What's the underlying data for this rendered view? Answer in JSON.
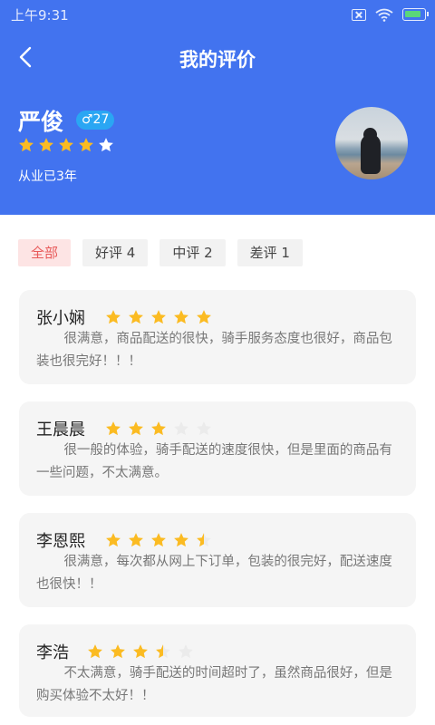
{
  "status_bar": {
    "time": "上午9:31",
    "battery_level": 0.75,
    "icons": [
      "sim-off-icon",
      "wifi-icon",
      "battery-charging-icon"
    ]
  },
  "nav": {
    "title": "我的评价",
    "back_icon": "back-arrow-icon"
  },
  "profile": {
    "name": "严俊",
    "gender_age": "♂27",
    "rating": 4,
    "rating_max": 5,
    "experience": "从业已3年"
  },
  "tabs": [
    {
      "label": "全部",
      "active": true
    },
    {
      "label": "好评 4",
      "active": false
    },
    {
      "label": "中评 2",
      "active": false
    },
    {
      "label": "差评 1",
      "active": false
    }
  ],
  "reviews": [
    {
      "name": "张小娴",
      "rating": 5,
      "text": "很满意，商品配送的很快，骑手服务态度也很好，商品包装也很完好！！！"
    },
    {
      "name": "王晨晨",
      "rating": 3,
      "text": "很一般的体验，骑手配送的速度很快，但是里面的商品有一些问题，不太满意。"
    },
    {
      "name": "李恩熙",
      "rating": 4.5,
      "text": "很满意，每次都从网上下订单，包装的很完好，配送速度也很快！！"
    },
    {
      "name": "李浩",
      "rating": 3.5,
      "text": "不太满意，骑手配送的时间超时了，虽然商品很好，但是购买体验不太好！！"
    }
  ],
  "colors": {
    "primary": "#4273ef",
    "star_filled": "#fbbb22",
    "star_empty_header": "#ffffff",
    "star_empty_card": "#ebebeb",
    "tab_active_bg": "#fde4e4",
    "tab_active_text": "#e85a5a",
    "badge": "#2aa6f3"
  }
}
